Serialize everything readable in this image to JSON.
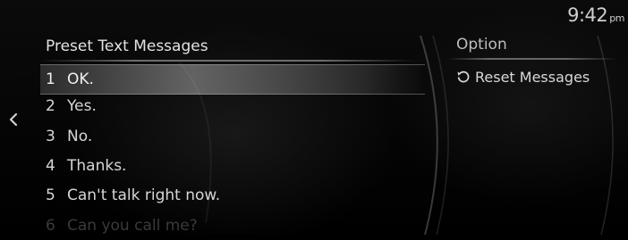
{
  "status": {
    "time": "9:42",
    "ampm": "pm"
  },
  "list": {
    "title": "Preset Text Messages",
    "items": [
      {
        "number": "1",
        "text": "OK.",
        "selected": true
      },
      {
        "number": "2",
        "text": "Yes.",
        "selected": false
      },
      {
        "number": "3",
        "text": "No.",
        "selected": false
      },
      {
        "number": "4",
        "text": "Thanks.",
        "selected": false
      },
      {
        "number": "5",
        "text": "Can't talk right now.",
        "selected": false
      },
      {
        "number": "6",
        "text": "Can you call me?",
        "selected": false
      }
    ]
  },
  "options": {
    "title": "Option",
    "items": [
      {
        "label": "Reset Messages",
        "icon": "reset-icon"
      }
    ]
  },
  "nav": {
    "back_icon": "chevron-left-icon"
  },
  "colors": {
    "background": "#000000",
    "text": "#d6d6d6",
    "highlight": "#c8c8c8"
  }
}
